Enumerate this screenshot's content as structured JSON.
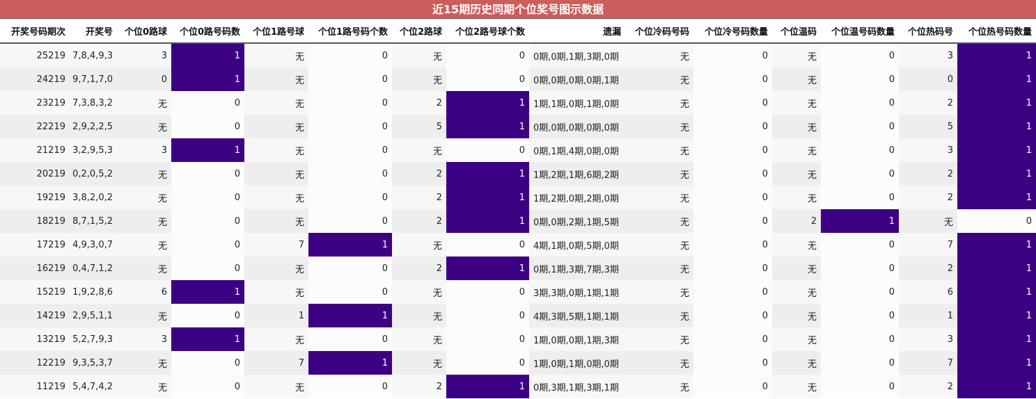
{
  "title": "近15期历史同期个位奖号图示数据",
  "colors": {
    "title_bg": "#cd5c5c",
    "highlight": "#3c0082"
  },
  "headers": [
    "开奖号码期次",
    "开奖号",
    "个位0路球",
    "个位0路号码数",
    "个位1路号球",
    "个位1路号码个数",
    "个位2路球",
    "个位2路号球个数",
    "遗漏",
    "个位冷码号码",
    "个位冷号码数量",
    "个位温码",
    "个位温号码数量",
    "个位热码号",
    "个位热号码数量"
  ],
  "rows": [
    [
      "25219",
      "7,8,4,9,3",
      "3",
      "1",
      "无",
      "0",
      "无",
      "0",
      "0期,0期,1期,3期,0期",
      "无",
      "0",
      "无",
      "0",
      "3",
      "1"
    ],
    [
      "24219",
      "9,7,1,7,0",
      "0",
      "1",
      "无",
      "0",
      "无",
      "0",
      "0期,0期,0期,0期,1期",
      "无",
      "0",
      "无",
      "0",
      "0",
      "1"
    ],
    [
      "23219",
      "7,3,8,3,2",
      "无",
      "0",
      "无",
      "0",
      "2",
      "1",
      "1期,1期,0期,1期,0期",
      "无",
      "0",
      "无",
      "0",
      "2",
      "1"
    ],
    [
      "22219",
      "2,9,2,2,5",
      "无",
      "0",
      "无",
      "0",
      "5",
      "1",
      "0期,0期,0期,0期,0期",
      "无",
      "0",
      "无",
      "0",
      "5",
      "1"
    ],
    [
      "21219",
      "3,2,9,5,3",
      "3",
      "1",
      "无",
      "0",
      "无",
      "0",
      "0期,1期,4期,0期,0期",
      "无",
      "0",
      "无",
      "0",
      "3",
      "1"
    ],
    [
      "20219",
      "0,2,0,5,2",
      "无",
      "0",
      "无",
      "0",
      "2",
      "1",
      "1期,2期,1期,6期,2期",
      "无",
      "0",
      "无",
      "0",
      "2",
      "1"
    ],
    [
      "19219",
      "3,8,2,0,2",
      "无",
      "0",
      "无",
      "0",
      "2",
      "1",
      "1期,2期,0期,2期,0期",
      "无",
      "0",
      "无",
      "0",
      "2",
      "1"
    ],
    [
      "18219",
      "8,7,1,5,2",
      "无",
      "0",
      "无",
      "0",
      "2",
      "1",
      "0期,0期,2期,1期,5期",
      "无",
      "0",
      "2",
      "1",
      "无",
      "0"
    ],
    [
      "17219",
      "4,9,3,0,7",
      "无",
      "0",
      "7",
      "1",
      "无",
      "0",
      "4期,1期,0期,5期,0期",
      "无",
      "0",
      "无",
      "0",
      "7",
      "1"
    ],
    [
      "16219",
      "0,4,7,1,2",
      "无",
      "0",
      "无",
      "0",
      "2",
      "1",
      "0期,1期,3期,7期,3期",
      "无",
      "0",
      "无",
      "0",
      "2",
      "1"
    ],
    [
      "15219",
      "1,9,2,8,6",
      "6",
      "1",
      "无",
      "0",
      "无",
      "0",
      "3期,3期,0期,1期,1期",
      "无",
      "0",
      "无",
      "0",
      "6",
      "1"
    ],
    [
      "14219",
      "2,9,5,1,1",
      "无",
      "0",
      "1",
      "1",
      "无",
      "0",
      "4期,3期,5期,1期,1期",
      "无",
      "0",
      "无",
      "0",
      "1",
      "1"
    ],
    [
      "13219",
      "5,2,7,9,3",
      "3",
      "1",
      "无",
      "0",
      "无",
      "0",
      "1期,0期,0期,1期,3期",
      "无",
      "0",
      "无",
      "0",
      "3",
      "1"
    ],
    [
      "12219",
      "9,3,5,3,7",
      "无",
      "0",
      "7",
      "1",
      "无",
      "0",
      "1期,0期,1期,0期,0期",
      "无",
      "0",
      "无",
      "0",
      "7",
      "1"
    ],
    [
      "11219",
      "5,4,7,4,2",
      "无",
      "0",
      "无",
      "0",
      "2",
      "1",
      "0期,3期,1期,3期,1期",
      "无",
      "0",
      "无",
      "0",
      "2",
      "1"
    ]
  ]
}
